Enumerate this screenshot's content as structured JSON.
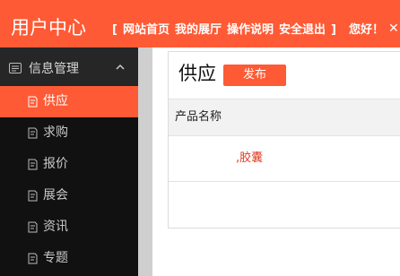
{
  "header": {
    "title": "用户中心",
    "nav_open": "[",
    "nav_close": "]",
    "nav": [
      "网站首页",
      "我的展厅",
      "操作说明",
      "安全退出"
    ],
    "greeting": "您好！"
  },
  "sidebar": {
    "group_label": "信息管理",
    "items": [
      {
        "label": "供应",
        "active": true
      },
      {
        "label": "求购",
        "active": false
      },
      {
        "label": "报价",
        "active": false
      },
      {
        "label": "展会",
        "active": false
      },
      {
        "label": "资讯",
        "active": false
      },
      {
        "label": "专题",
        "active": false
      }
    ]
  },
  "main": {
    "title": "供应",
    "publish_label": "发布",
    "table": {
      "headers": [
        "产品名称"
      ],
      "rows": [
        [
          ",胶囊"
        ]
      ]
    }
  },
  "colors": {
    "accent": "#fe5a35",
    "sidebar_bg": "#262626",
    "sidebar_list_bg": "#111111",
    "link_red": "#e03a1e"
  },
  "icons": {
    "group": "list-icon",
    "collapse": "chevron-up-icon",
    "item": "edit-document-icon",
    "close": "close-icon"
  }
}
